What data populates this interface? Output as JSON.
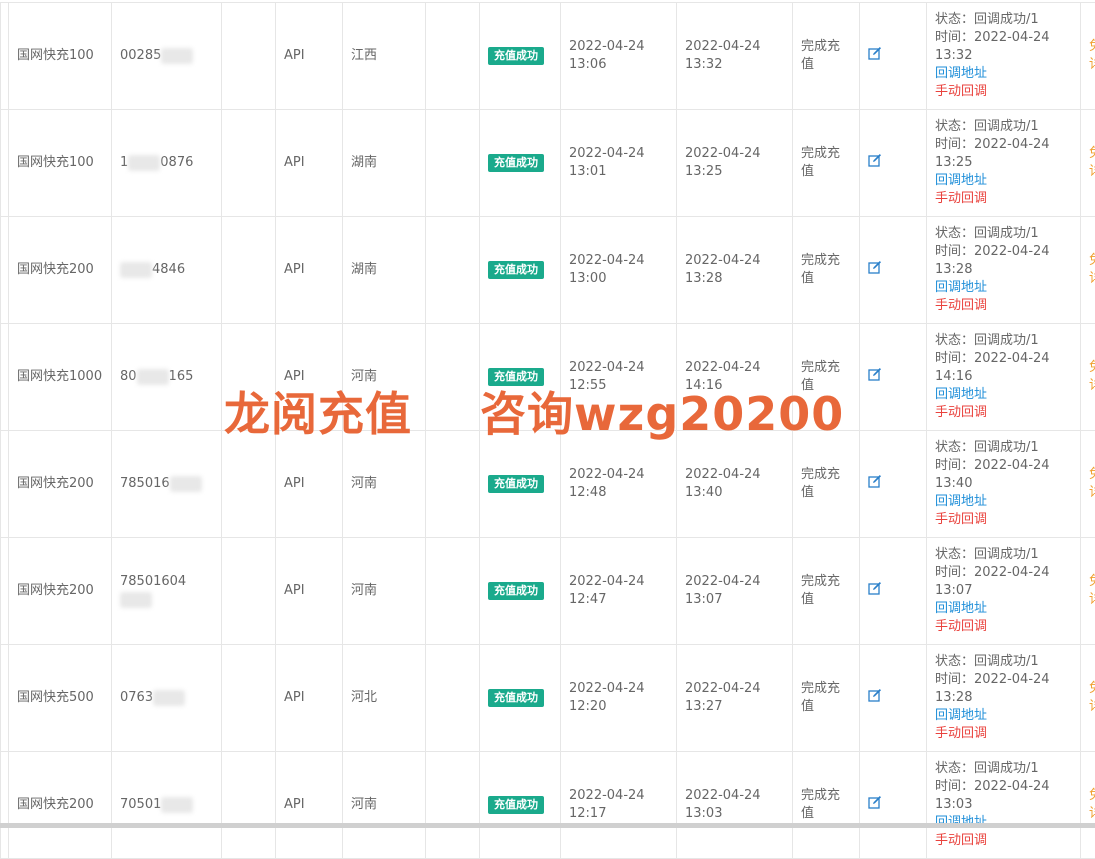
{
  "rows": [
    {
      "product": "国网快充100",
      "acc_pre": "00285",
      "acc_post": "",
      "channel": "API",
      "region": "江西",
      "status": "充值成功",
      "t1": "2022-04-24 13:06",
      "t2": "2022-04-24 13:32",
      "result": "完成充值",
      "cb_status": "状态：回调成功/1",
      "cb_time_prefix": "时间：2022-04-24",
      "cb_time_clock": "13:32",
      "cb_link": "回调地址",
      "cb_manual": "手动回调",
      "last": "免详"
    },
    {
      "product": "国网快充100",
      "acc_pre": "1",
      "acc_post": "0876",
      "channel": "API",
      "region": "湖南",
      "status": "充值成功",
      "t1": "2022-04-24 13:01",
      "t2": "2022-04-24 13:25",
      "result": "完成充值",
      "cb_status": "状态：回调成功/1",
      "cb_time_prefix": "时间：2022-04-24",
      "cb_time_clock": "13:25",
      "cb_link": "回调地址",
      "cb_manual": "手动回调",
      "last": "免详"
    },
    {
      "product": "国网快充200",
      "acc_pre": "",
      "acc_post": "4846",
      "channel": "API",
      "region": "湖南",
      "status": "充值成功",
      "t1": "2022-04-24 13:00",
      "t2": "2022-04-24 13:28",
      "result": "完成充值",
      "cb_status": "状态：回调成功/1",
      "cb_time_prefix": "时间：2022-04-24",
      "cb_time_clock": "13:28",
      "cb_link": "回调地址",
      "cb_manual": "手动回调",
      "last": "免详"
    },
    {
      "product": "国网快充1000",
      "acc_pre": "80",
      "acc_post": "165",
      "channel": "API",
      "region": "河南",
      "status": "充值成功",
      "t1": "2022-04-24 12:55",
      "t2": "2022-04-24 14:16",
      "result": "完成充值",
      "cb_status": "状态：回调成功/1",
      "cb_time_prefix": "时间：2022-04-24",
      "cb_time_clock": "14:16",
      "cb_link": "回调地址",
      "cb_manual": "手动回调",
      "last": "免详"
    },
    {
      "product": "国网快充200",
      "acc_pre": "785016",
      "acc_post": "",
      "channel": "API",
      "region": "河南",
      "status": "充值成功",
      "t1": "2022-04-24 12:48",
      "t2": "2022-04-24 13:40",
      "result": "完成充值",
      "cb_status": "状态：回调成功/1",
      "cb_time_prefix": "时间：2022-04-24",
      "cb_time_clock": "13:40",
      "cb_link": "回调地址",
      "cb_manual": "手动回调",
      "last": "免详"
    },
    {
      "product": "国网快充200",
      "acc_pre": "78501604",
      "acc_post": "",
      "channel": "API",
      "region": "河南",
      "status": "充值成功",
      "t1": "2022-04-24 12:47",
      "t2": "2022-04-24 13:07",
      "result": "完成充值",
      "cb_status": "状态：回调成功/1",
      "cb_time_prefix": "时间：2022-04-24",
      "cb_time_clock": "13:07",
      "cb_link": "回调地址",
      "cb_manual": "手动回调",
      "last": "免详"
    },
    {
      "product": "国网快充500",
      "acc_pre": "0763",
      "acc_post": "",
      "channel": "API",
      "region": "河北",
      "status": "充值成功",
      "t1": "2022-04-24 12:20",
      "t2": "2022-04-24 13:27",
      "result": "完成充值",
      "cb_status": "状态：回调成功/1",
      "cb_time_prefix": "时间：2022-04-24",
      "cb_time_clock": "13:28",
      "cb_link": "回调地址",
      "cb_manual": "手动回调",
      "last": "免详"
    },
    {
      "product": "国网快充200",
      "acc_pre": "70501",
      "acc_post": "",
      "channel": "API",
      "region": "河南",
      "status": "充值成功",
      "t1": "2022-04-24 12:17",
      "t2": "2022-04-24 13:03",
      "result": "完成充值",
      "cb_status": "状态：回调成功/1",
      "cb_time_prefix": "时间：2022-04-24",
      "cb_time_clock": "13:03",
      "cb_link": "回调地址",
      "cb_manual": "手动回调",
      "last": "免详"
    }
  ],
  "watermark": "龙阅充值    咨询wzg20200",
  "colors": {
    "badge": "#1aaa8c",
    "link": "#1e8ed8",
    "manual": "#e9423d",
    "last": "#f0a030",
    "watermark": "#e8683a"
  },
  "icons": {
    "edit": "edit-icon"
  }
}
